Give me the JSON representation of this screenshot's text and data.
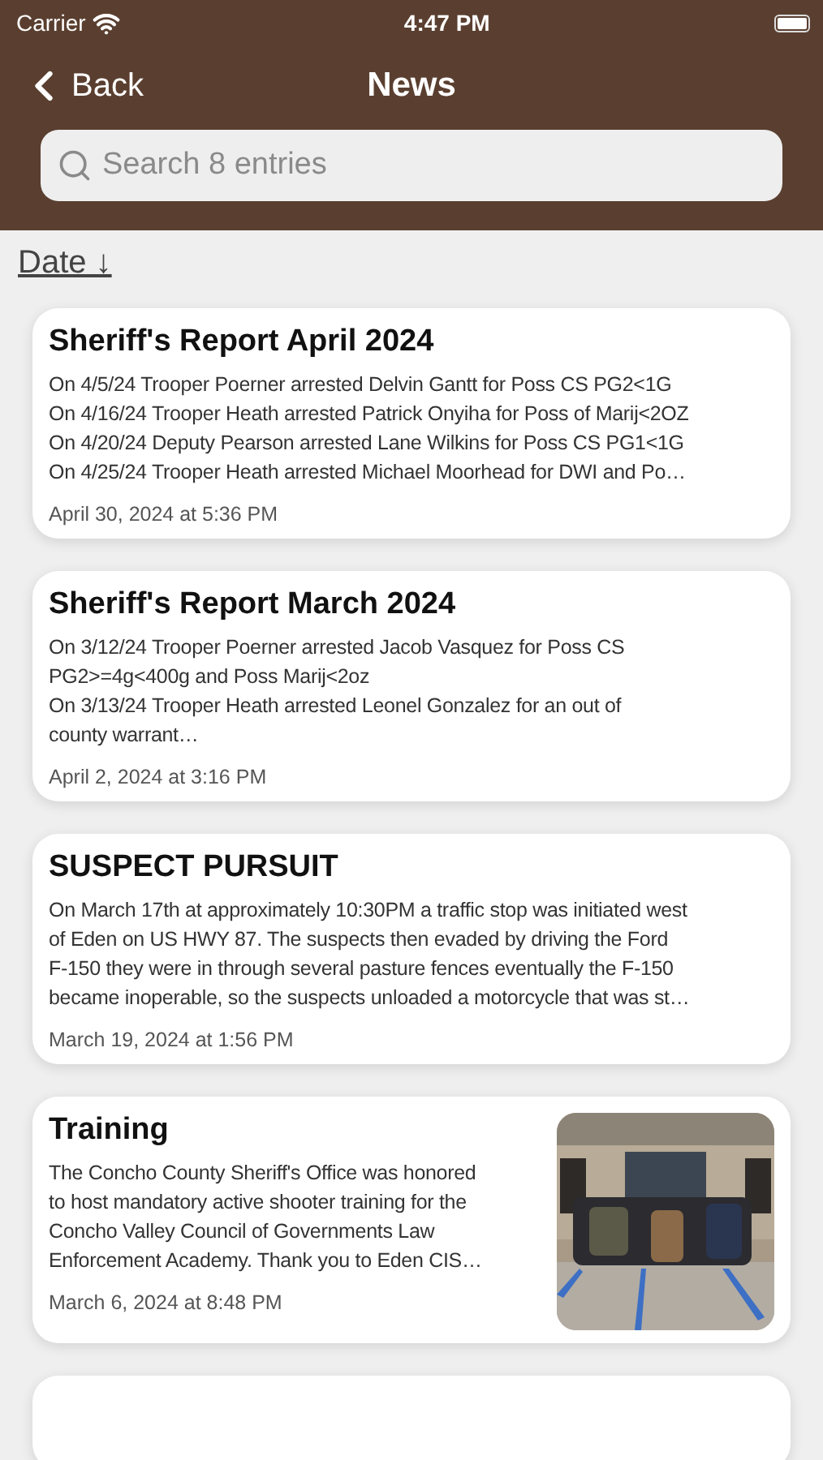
{
  "status_bar": {
    "carrier": "Carrier",
    "time": "4:47 PM"
  },
  "nav": {
    "back": "Back",
    "title": "News"
  },
  "search": {
    "placeholder": "Search 8 entries"
  },
  "sort": {
    "label": "Date ↓"
  },
  "entries": [
    {
      "title": "Sheriff's Report April 2024",
      "body": "On 4/5/24 Trooper Poerner arrested Delvin Gantt for Poss CS PG2<1G\nOn 4/16/24 Trooper Heath arrested Patrick Onyiha for Poss of Marij<2OZ\nOn 4/20/24 Deputy Pearson arrested Lane Wilkins for Poss CS PG1<1G\nOn 4/25/24 Trooper Heath arrested Michael Moorhead for DWI and Po…",
      "date": "April 30, 2024 at 5:36 PM"
    },
    {
      "title": "Sheriff's Report March 2024",
      "body": "On 3/12/24 Trooper Poerner arrested Jacob Vasquez for Poss CS\nPG2>=4g<400g and Poss Marij<2oz\nOn 3/13/24 Trooper Heath arrested Leonel Gonzalez for an out of\ncounty warrant…",
      "date": "April 2, 2024 at 3:16 PM"
    },
    {
      "title": "SUSPECT PURSUIT",
      "body": "On March 17th at approximately 10:30PM a traffic stop was initiated west\nof Eden on US HWY 87. The suspects then evaded by driving the Ford\nF-150 they were in through several pasture fences eventually the F-150\nbecame inoperable, so the suspects unloaded a motorcycle that was st…",
      "date": "March 19, 2024 at 1:56 PM"
    },
    {
      "title": "Training",
      "body": "The Concho County Sheriff's Office was honored\nto host mandatory active shooter training for the\nConcho Valley Council of Governments Law\nEnforcement Academy. Thank you to Eden CIS…",
      "date": "March 6, 2024 at 8:48 PM"
    },
    {
      "kind": "partial"
    }
  ]
}
